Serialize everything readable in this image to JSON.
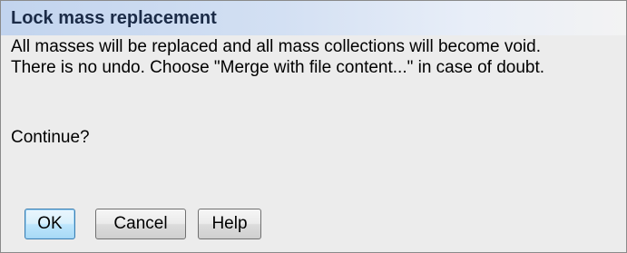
{
  "dialog": {
    "title": "Lock mass replacement",
    "message_lines": [
      "All masses will be replaced and all mass collections will become void.",
      "There is no undo. Choose \"Merge with file content...\" in case of doubt."
    ],
    "question": "Continue?",
    "buttons": {
      "ok": "OK",
      "cancel": "Cancel",
      "help": "Help"
    }
  },
  "colors": {
    "title_gradient_start": "#c2d4ee",
    "title_text": "#1b2b47",
    "dialog_background": "#ececec",
    "default_button_border": "#3c7fb1"
  }
}
